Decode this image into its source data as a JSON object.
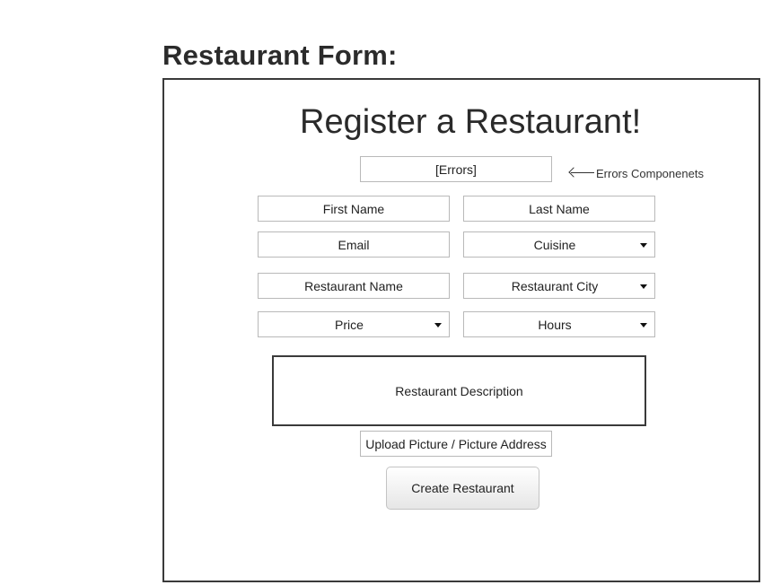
{
  "page_title": "Restaurant Form:",
  "form": {
    "heading": "Register a Restaurant!",
    "errors_placeholder": "[Errors]",
    "errors_annotation": "Errors Componenets",
    "first_name": "First Name",
    "last_name": "Last Name",
    "email": "Email",
    "cuisine": "Cuisine",
    "restaurant_name": "Restaurant Name",
    "restaurant_city": "Restaurant City",
    "price": "Price",
    "hours": "Hours",
    "description": "Restaurant Description",
    "upload_picture": "Upload Picture / Picture Address",
    "create_button": "Create Restaurant"
  },
  "icons": {
    "annotation_arrow": "arrow-left-icon",
    "dropdown_caret": "caret-down-icon"
  },
  "colors": {
    "frame_border": "#3a3a3a",
    "field_border": "#b9b9b9",
    "text": "#222222"
  }
}
